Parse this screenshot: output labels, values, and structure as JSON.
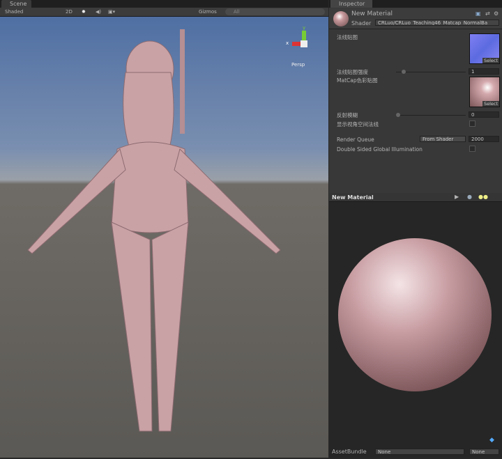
{
  "scene": {
    "tab": "Scene",
    "shading": "Shaded",
    "mode_2d": "2D",
    "gizmos": "Gizmos",
    "search_placeholder": "All",
    "persp": "Persp",
    "axes": {
      "y": "y",
      "x": "x"
    }
  },
  "inspector": {
    "tab": "Inspector",
    "material_name": "New Material",
    "shader_label": "Shader",
    "shader_value": "CRLuo/CRLuo_Teaching46_Matcap_NormalBa",
    "properties": [
      {
        "label": "法线贴图",
        "select": "Select"
      },
      {
        "label": "法线贴图强度",
        "value": "1"
      },
      {
        "label": "MatCap色彩贴图",
        "select": "Select"
      },
      {
        "label": "反射模糊",
        "value": "0"
      },
      {
        "label": "显示视角空间法线"
      }
    ],
    "render_queue_label": "Render Queue",
    "render_queue_mode": "From Shader",
    "render_queue_value": "2000",
    "dsgi_label": "Double Sided Global Illumination"
  },
  "preview": {
    "title": "New Material"
  },
  "asset_bundle": {
    "label": "AssetBundle",
    "name": "None",
    "variant": "None"
  }
}
